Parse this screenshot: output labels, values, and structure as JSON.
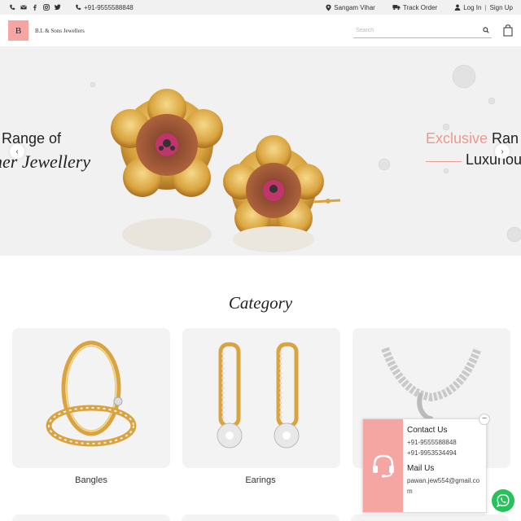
{
  "topbar": {
    "phone": "+91-9555588848",
    "location": "Sangam Vihar",
    "track_order": "Track Order",
    "login": "Log In",
    "separator": "|",
    "signup": "Sign Up"
  },
  "header": {
    "logo_letter": "B",
    "brand_name": "B.L & Sons Jewellers",
    "search_placeholder": "Search"
  },
  "hero": {
    "left_line1": "Range of",
    "left_line2": "her Jewellery",
    "right_line1_accent": "Exclusive",
    "right_line1_rest": " Ran",
    "right_line2": "Luxuriou",
    "prev": "‹",
    "next": "›"
  },
  "category": {
    "title": "Category",
    "items": [
      {
        "label": "Bangles"
      },
      {
        "label": "Earings"
      },
      {
        "label": ""
      }
    ]
  },
  "contact": {
    "title": "Contact Us",
    "phone1": "+91-9555588848",
    "phone2": "+91-9953534494",
    "mail_title": "Mail Us",
    "email": "pawan.jew554@gmail.com",
    "close": "−"
  },
  "colors": {
    "accent": "#f5a6a3",
    "accent_text": "#e99a8f",
    "whatsapp": "#25c35a",
    "gold": "#d9a43f"
  }
}
